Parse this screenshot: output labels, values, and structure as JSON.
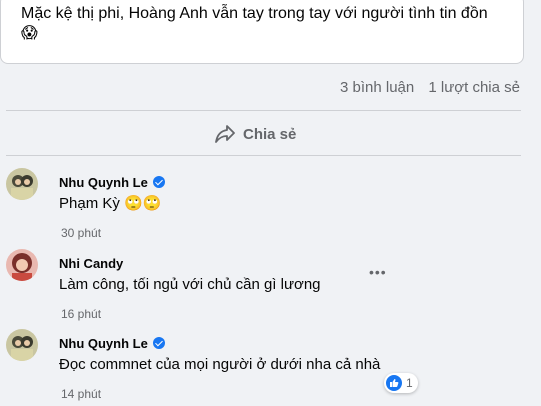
{
  "post": {
    "text": "Mặc kệ thị phi, Hoàng Anh vẫn tay trong tay với người tình tin đồn",
    "emoji": "😱"
  },
  "stats": {
    "comments": "3 bình luận",
    "shares": "1 lượt chia sẻ"
  },
  "share_label": "Chia sẻ",
  "comments": [
    {
      "name": "Nhu Quynh Le",
      "text": "Phạm Kỳ 🙄🙄",
      "time": "30 phút"
    },
    {
      "name": "Nhi Candy",
      "text": "Làm công, tối ngủ với chủ cần gì lương",
      "time": "16 phút"
    },
    {
      "name": "Nhu Quynh Le",
      "text": "Đọc commnet của mọi người ở dưới nha cả nhà",
      "time": "14 phút",
      "reactions": "1"
    }
  ],
  "colors": {
    "accent": "#1877f2",
    "bubble": "#f0f2f5",
    "muted": "#65676b"
  }
}
